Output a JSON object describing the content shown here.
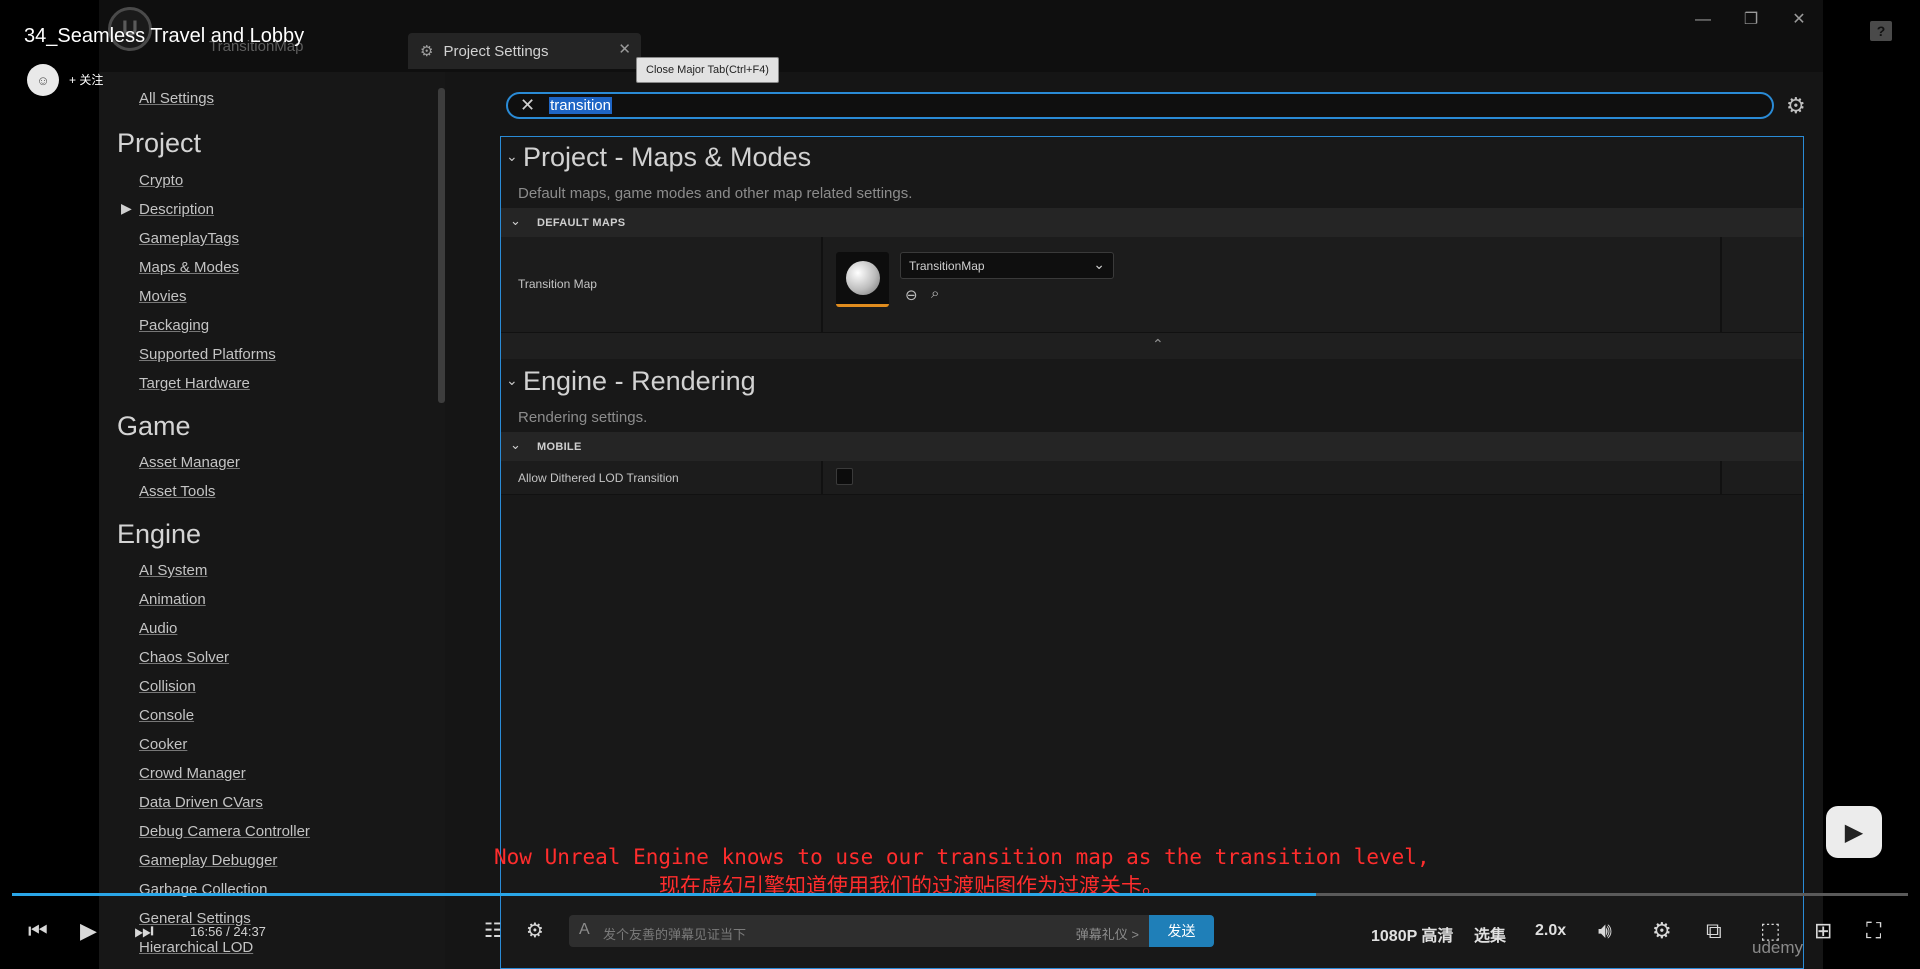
{
  "video": {
    "title": "34_Seamless Travel and Lobby",
    "follow_label": "+ 关注",
    "subtitle_en": "Now Unreal Engine knows to use our transition map as the transition level,",
    "subtitle_zh": "现在虚幻引擎知道使用我们的过渡贴图作为过渡关卡。",
    "watermark": "udemy",
    "help_icon": "?"
  },
  "editor": {
    "level_name": "TransitionMap",
    "tab_label": "Project Settings",
    "tooltip": "Close Major Tab(Ctrl+F4)",
    "window_controls": [
      "—",
      "❐",
      "✕"
    ]
  },
  "nav": {
    "all_settings": "All Settings",
    "sections": [
      {
        "title": "Project",
        "items": [
          "Crypto",
          "Description",
          "GameplayTags",
          "Maps & Modes",
          "Movies",
          "Packaging",
          "Supported Platforms",
          "Target Hardware"
        ]
      },
      {
        "title": "Game",
        "items": [
          "Asset Manager",
          "Asset Tools"
        ]
      },
      {
        "title": "Engine",
        "items": [
          "AI System",
          "Animation",
          "Audio",
          "Chaos Solver",
          "Collision",
          "Console",
          "Cooker",
          "Crowd Manager",
          "Data Driven CVars",
          "Debug Camera Controller",
          "Gameplay Debugger",
          "Garbage Collection",
          "General Settings",
          "Hierarchical LOD"
        ]
      }
    ]
  },
  "search": {
    "value": "transition"
  },
  "details": {
    "sections": [
      {
        "title": "Project - Maps & Modes",
        "description": "Default maps, game modes and other map related settings.",
        "category": "DEFAULT MAPS",
        "property": "Transition Map",
        "value": "TransitionMap"
      },
      {
        "title": "Engine - Rendering",
        "description": "Rendering settings.",
        "category": "MOBILE",
        "property": "Allow Dithered LOD Transition",
        "checked": false
      }
    ]
  },
  "player": {
    "time": "16:56 / 24:37",
    "progress": 0.688,
    "danmaku_placeholder": "发个友善的弹幕见证当下",
    "danmaku_etiquette": "弹幕礼仪 >",
    "send_label": "发送",
    "quality": "1080P 高清",
    "episodes": "选集",
    "speed": "2.0x"
  }
}
